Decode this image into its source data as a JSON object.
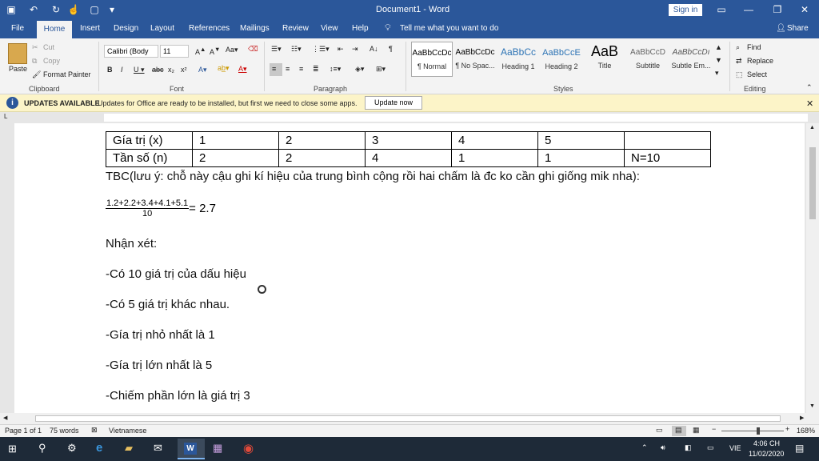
{
  "window": {
    "title": "Document1 - Word",
    "signin": "Sign in"
  },
  "tabs": [
    "File",
    "Home",
    "Insert",
    "Design",
    "Layout",
    "References",
    "Mailings",
    "Review",
    "View",
    "Help"
  ],
  "tell_me": "Tell me what you want to do",
  "share": "Share",
  "clipboard": {
    "paste": "Paste",
    "cut": "Cut",
    "copy": "Copy",
    "format_painter": "Format Painter",
    "label": "Clipboard"
  },
  "font": {
    "name": "Calibri (Body",
    "size": "11",
    "label": "Font"
  },
  "paragraph": {
    "label": "Paragraph"
  },
  "styles": {
    "label": "Styles",
    "items": [
      {
        "preview": "AaBbCcDc",
        "name": "¶ Normal"
      },
      {
        "preview": "AaBbCcDc",
        "name": "¶ No Spac..."
      },
      {
        "preview": "AaBbCc",
        "name": "Heading 1"
      },
      {
        "preview": "AaBbCcE",
        "name": "Heading 2"
      },
      {
        "preview": "AaB",
        "name": "Title"
      },
      {
        "preview": "AaBbCcD",
        "name": "Subtitle"
      },
      {
        "preview": "AaBbCcDı",
        "name": "Subtle Em..."
      }
    ]
  },
  "editing": {
    "find": "Find",
    "replace": "Replace",
    "select": "Select",
    "label": "Editing"
  },
  "update_bar": {
    "title": "UPDATES AVAILABLE",
    "message": "Updates for Office are ready to be installed, but first we need to close some apps.",
    "button": "Update now"
  },
  "doc": {
    "table": {
      "rows": [
        [
          "Gía trị (x)",
          "1",
          "2",
          "3",
          "4",
          "5",
          ""
        ],
        [
          "Tần số (n)",
          "2",
          "2",
          "4",
          "1",
          "1",
          "N=10"
        ]
      ]
    },
    "tbc_line": "TBC(lưu ý: chỗ này cậu ghi kí hiệu của trung bình cộng rồi hai chấm là đc ko cần ghi giống mik nha):",
    "fraction_num": "1.2+2.2+3.4+4.1+5.1",
    "fraction_den": "10",
    "fraction_result": "= 2.7",
    "remarks": [
      "Nhận xét:",
      "-Có 10 giá trị của dấu hiệu",
      "-Có 5 giá trị khác nhau.",
      "-Gía trị nhỏ nhất là 1",
      "-Gía trị lớn nhất là 5",
      "-Chiếm phần lớn là giá trị 3"
    ]
  },
  "status": {
    "page": "Page 1 of 1",
    "words": "75 words",
    "language": "Vietnamese",
    "zoom": "168%"
  },
  "taskbar": {
    "lang": "VIE",
    "time": "4:06 CH",
    "date": "11/02/2020"
  }
}
